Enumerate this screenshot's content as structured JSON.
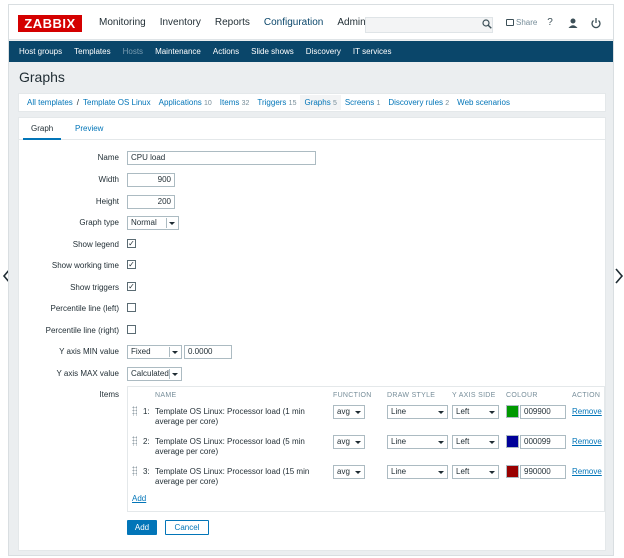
{
  "header": {
    "logo": "ZABBIX",
    "menu": [
      "Monitoring",
      "Inventory",
      "Reports",
      "Configuration",
      "Administrat"
    ],
    "share_label": "Share",
    "help_glyph": "?"
  },
  "submenu": [
    "Host groups",
    "Templates",
    "Hosts",
    "Maintenance",
    "Actions",
    "Slide shows",
    "Discovery",
    "IT services"
  ],
  "page_title": "Graphs",
  "breadcrumbs": {
    "all_templates": "All templates",
    "separator": "/",
    "template": "Template OS Linux",
    "applications": "Applications",
    "applications_count": "10",
    "items": "Items",
    "items_count": "32",
    "triggers": "Triggers",
    "triggers_count": "15",
    "graphs": "Graphs",
    "graphs_count": "5",
    "screens": "Screens",
    "screens_count": "1",
    "discovery": "Discovery rules",
    "discovery_count": "2",
    "web": "Web scenarios"
  },
  "tabs": [
    "Graph",
    "Preview"
  ],
  "form": {
    "name_label": "Name",
    "name_value": "CPU load",
    "width_label": "Width",
    "width_value": "900",
    "height_label": "Height",
    "height_value": "200",
    "graph_type_label": "Graph type",
    "graph_type_value": "Normal",
    "show_legend_label": "Show legend",
    "show_working_time_label": "Show working time",
    "show_triggers_label": "Show triggers",
    "percentile_left_label": "Percentile line (left)",
    "percentile_right_label": "Percentile line (right)",
    "ymin_label": "Y axis MIN value",
    "ymin_type": "Fixed",
    "ymin_value": "0.0000",
    "ymax_label": "Y axis MAX value",
    "ymax_type": "Calculated",
    "items_label": "Items",
    "check_glyph": "✓",
    "checks": {
      "show_legend": true,
      "show_working_time": true,
      "show_triggers": true,
      "percentile_left": false,
      "percentile_right": false
    }
  },
  "items_table": {
    "columns": [
      "NAME",
      "FUNCTION",
      "DRAW STYLE",
      "Y AXIS SIDE",
      "COLOUR",
      "ACTION"
    ],
    "rows": [
      {
        "idx": "1:",
        "name": "Template OS Linux: Processor load (1 min average per core)",
        "function": "avg",
        "draw_style": "Line",
        "y_axis_side": "Left",
        "colour": "009900",
        "colour_hex": "#009900",
        "action": "Remove"
      },
      {
        "idx": "2:",
        "name": "Template OS Linux: Processor load (5 min average per core)",
        "function": "avg",
        "draw_style": "Line",
        "y_axis_side": "Left",
        "colour": "000099",
        "colour_hex": "#000099",
        "action": "Remove"
      },
      {
        "idx": "3:",
        "name": "Template OS Linux: Processor load (15 min average per core)",
        "function": "avg",
        "draw_style": "Line",
        "y_axis_side": "Left",
        "colour": "990000",
        "colour_hex": "#990000",
        "action": "Remove"
      }
    ],
    "add_link": "Add"
  },
  "buttons": {
    "add": "Add",
    "cancel": "Cancel"
  },
  "colors": {
    "brand_red": "#d40000",
    "nav_blue": "#0a466a",
    "link_blue": "#0275b8"
  }
}
